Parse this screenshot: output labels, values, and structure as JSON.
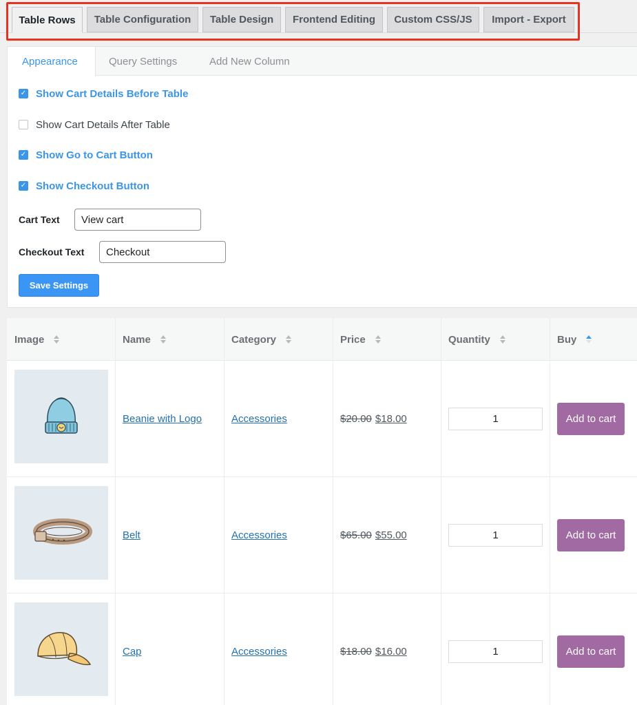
{
  "top_tabs": [
    {
      "label": "Table Rows",
      "active": true
    },
    {
      "label": "Table Configuration",
      "active": false
    },
    {
      "label": "Table Design",
      "active": false
    },
    {
      "label": "Frontend Editing",
      "active": false
    },
    {
      "label": "Custom CSS/JS",
      "active": false
    },
    {
      "label": "Import - Export",
      "active": false
    }
  ],
  "sub_tabs": [
    {
      "label": "Appearance",
      "active": true
    },
    {
      "label": "Query Settings",
      "active": false
    },
    {
      "label": "Add New Column",
      "active": false
    }
  ],
  "options": [
    {
      "label": "Show Cart Details Before Table",
      "checked": true
    },
    {
      "label": "Show Cart Details After Table",
      "checked": false
    },
    {
      "label": "Show Go to Cart Button",
      "checked": true
    },
    {
      "label": "Show Checkout Button",
      "checked": true
    }
  ],
  "fields": {
    "cart_text": {
      "label": "Cart Text",
      "value": "View cart"
    },
    "checkout_text": {
      "label": "Checkout Text",
      "value": "Checkout"
    }
  },
  "save_label": "Save Settings",
  "colors": {
    "accent": "#3b95e8",
    "highlight": "#e8321f",
    "cart_button": "#a26aa3"
  },
  "table": {
    "columns": [
      "Image",
      "Name",
      "Category",
      "Price",
      "Quantity",
      "Buy"
    ],
    "rows": [
      {
        "image_icon": "beanie-icon",
        "name": "Beanie with Logo",
        "category": "Accessories",
        "old_price": "$20.00",
        "price": "$18.00",
        "quantity": "1",
        "buy_label": "Add to cart"
      },
      {
        "image_icon": "belt-icon",
        "name": "Belt",
        "category": "Accessories",
        "old_price": "$65.00",
        "price": "$55.00",
        "quantity": "1",
        "buy_label": "Add to cart"
      },
      {
        "image_icon": "cap-icon",
        "name": "Cap",
        "category": "Accessories",
        "old_price": "$18.00",
        "price": "$16.00",
        "quantity": "1",
        "buy_label": "Add to cart"
      }
    ]
  }
}
